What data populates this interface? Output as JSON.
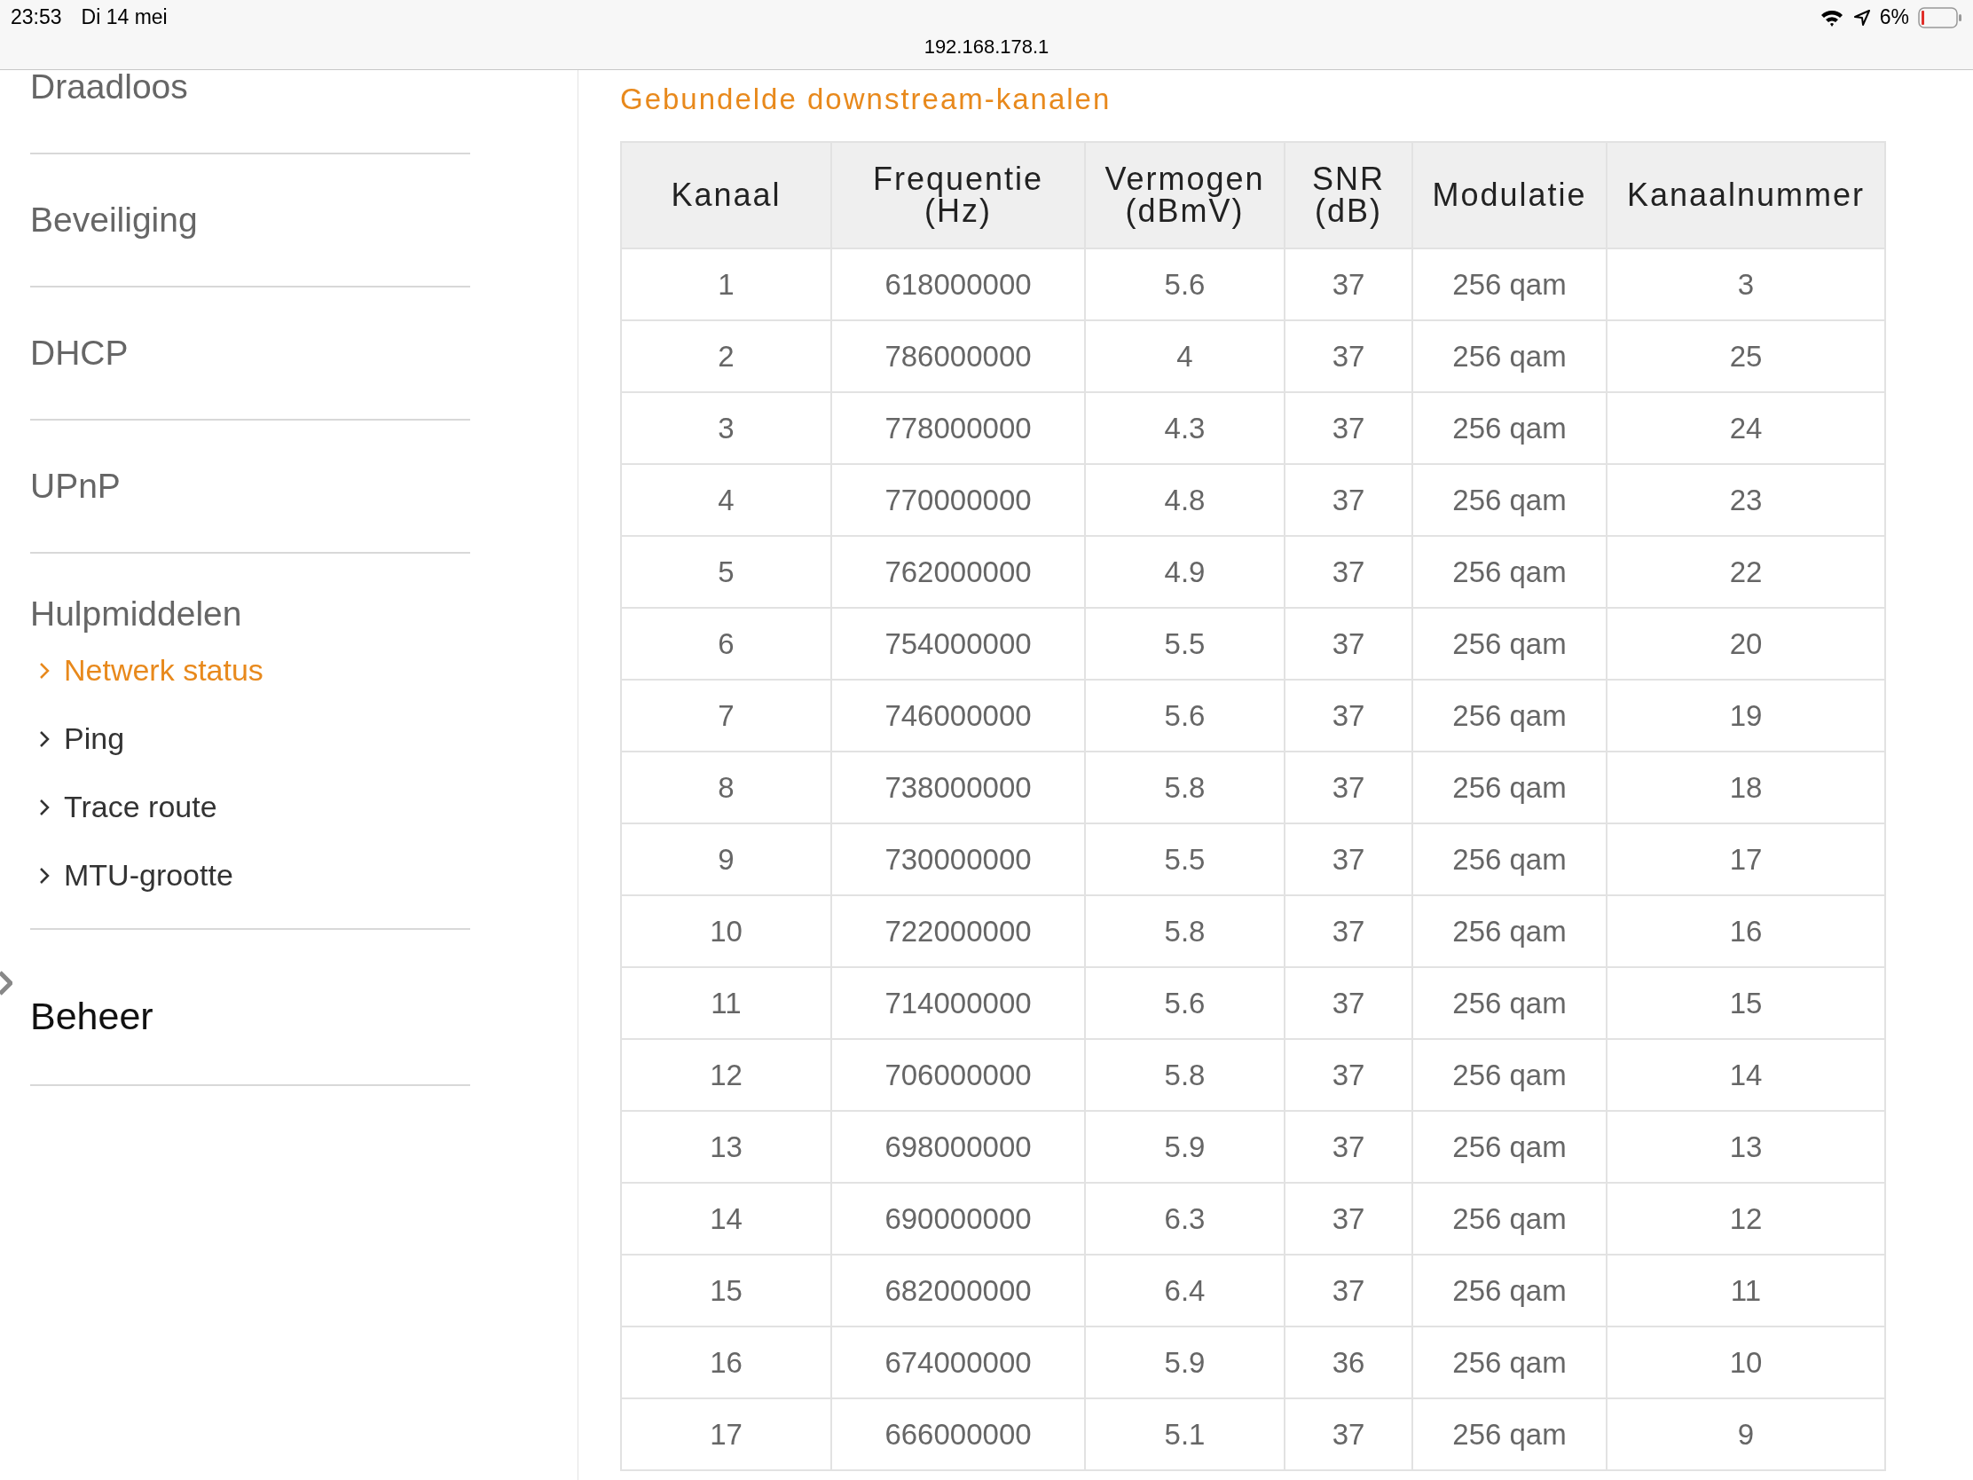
{
  "status_bar": {
    "time": "23:53",
    "date": "Di 14 mei",
    "url": "192.168.178.1",
    "battery": "6%"
  },
  "sidebar": {
    "items": [
      {
        "kind": "item",
        "label": "Draadloos"
      },
      {
        "kind": "item",
        "label": "Beveiliging"
      },
      {
        "kind": "item",
        "label": "DHCP"
      },
      {
        "kind": "item",
        "label": "UPnP"
      },
      {
        "kind": "item",
        "label": "Hulpmiddelen",
        "children": [
          {
            "label": "Netwerk status",
            "selected": true
          },
          {
            "label": "Ping",
            "selected": false
          },
          {
            "label": "Trace route",
            "selected": false
          },
          {
            "label": "MTU-grootte",
            "selected": false
          }
        ]
      },
      {
        "kind": "section",
        "label": "Beheer"
      }
    ]
  },
  "section_title": "Gebundelde downstream-kanalen",
  "table": {
    "columns": [
      "Kanaal",
      "Frequentie\n(Hz)",
      "Vermogen\n(dBmV)",
      "SNR\n(dB)",
      "Modulatie",
      "Kanaalnummer"
    ],
    "rows": [
      [
        "1",
        "618000000",
        "5.6",
        "37",
        "256 qam",
        "3"
      ],
      [
        "2",
        "786000000",
        "4",
        "37",
        "256 qam",
        "25"
      ],
      [
        "3",
        "778000000",
        "4.3",
        "37",
        "256 qam",
        "24"
      ],
      [
        "4",
        "770000000",
        "4.8",
        "37",
        "256 qam",
        "23"
      ],
      [
        "5",
        "762000000",
        "4.9",
        "37",
        "256 qam",
        "22"
      ],
      [
        "6",
        "754000000",
        "5.5",
        "37",
        "256 qam",
        "20"
      ],
      [
        "7",
        "746000000",
        "5.6",
        "37",
        "256 qam",
        "19"
      ],
      [
        "8",
        "738000000",
        "5.8",
        "37",
        "256 qam",
        "18"
      ],
      [
        "9",
        "730000000",
        "5.5",
        "37",
        "256 qam",
        "17"
      ],
      [
        "10",
        "722000000",
        "5.8",
        "37",
        "256 qam",
        "16"
      ],
      [
        "11",
        "714000000",
        "5.6",
        "37",
        "256 qam",
        "15"
      ],
      [
        "12",
        "706000000",
        "5.8",
        "37",
        "256 qam",
        "14"
      ],
      [
        "13",
        "698000000",
        "5.9",
        "37",
        "256 qam",
        "13"
      ],
      [
        "14",
        "690000000",
        "6.3",
        "37",
        "256 qam",
        "12"
      ],
      [
        "15",
        "682000000",
        "6.4",
        "37",
        "256 qam",
        "11"
      ],
      [
        "16",
        "674000000",
        "5.9",
        "36",
        "256 qam",
        "10"
      ],
      [
        "17",
        "666000000",
        "5.1",
        "37",
        "256 qam",
        "9"
      ]
    ]
  }
}
